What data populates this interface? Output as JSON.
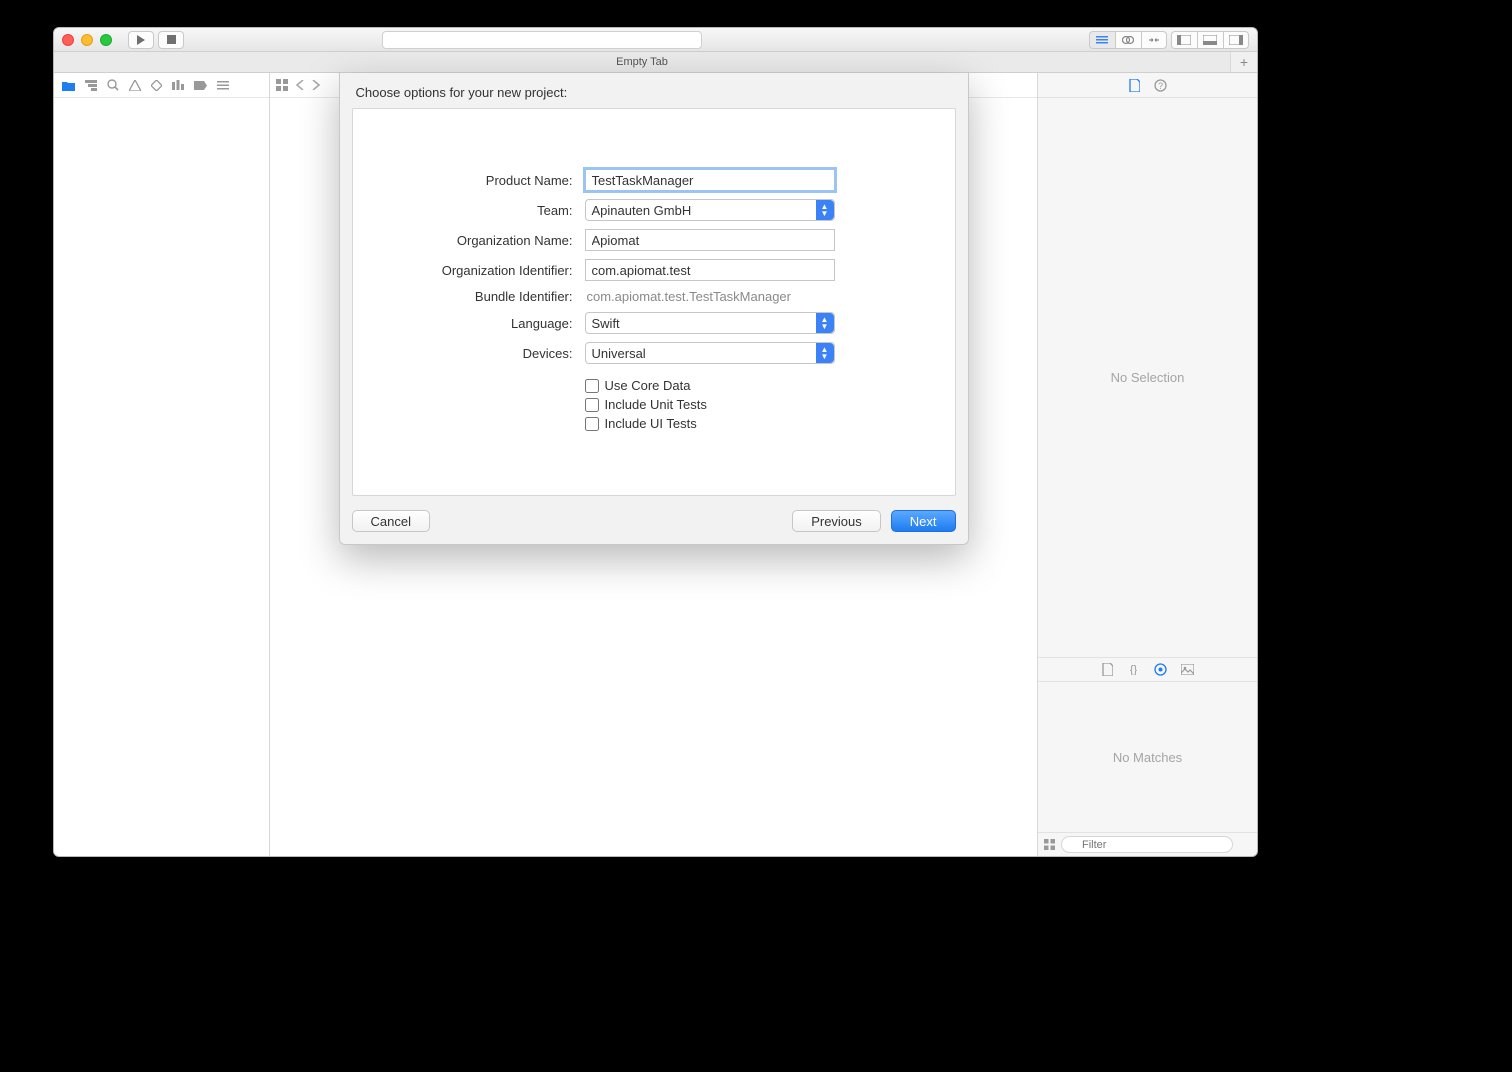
{
  "tabbar": {
    "tab_label": "Empty Tab",
    "add_label": "+"
  },
  "inspector": {
    "no_selection": "No Selection"
  },
  "library": {
    "no_matches": "No Matches",
    "filter_placeholder": "Filter"
  },
  "sheet": {
    "title": "Choose options for your new project:",
    "labels": {
      "product_name": "Product Name:",
      "team": "Team:",
      "org_name": "Organization Name:",
      "org_id": "Organization Identifier:",
      "bundle_id": "Bundle Identifier:",
      "language": "Language:",
      "devices": "Devices:"
    },
    "values": {
      "product_name": "TestTaskManager",
      "team": "Apinauten GmbH",
      "org_name": "Apiomat",
      "org_id": "com.apiomat.test",
      "bundle_id": "com.apiomat.test.TestTaskManager",
      "language": "Swift",
      "devices": "Universal"
    },
    "checks": {
      "core_data": "Use Core Data",
      "unit_tests": "Include Unit Tests",
      "ui_tests": "Include UI Tests"
    },
    "buttons": {
      "cancel": "Cancel",
      "previous": "Previous",
      "next": "Next"
    }
  }
}
